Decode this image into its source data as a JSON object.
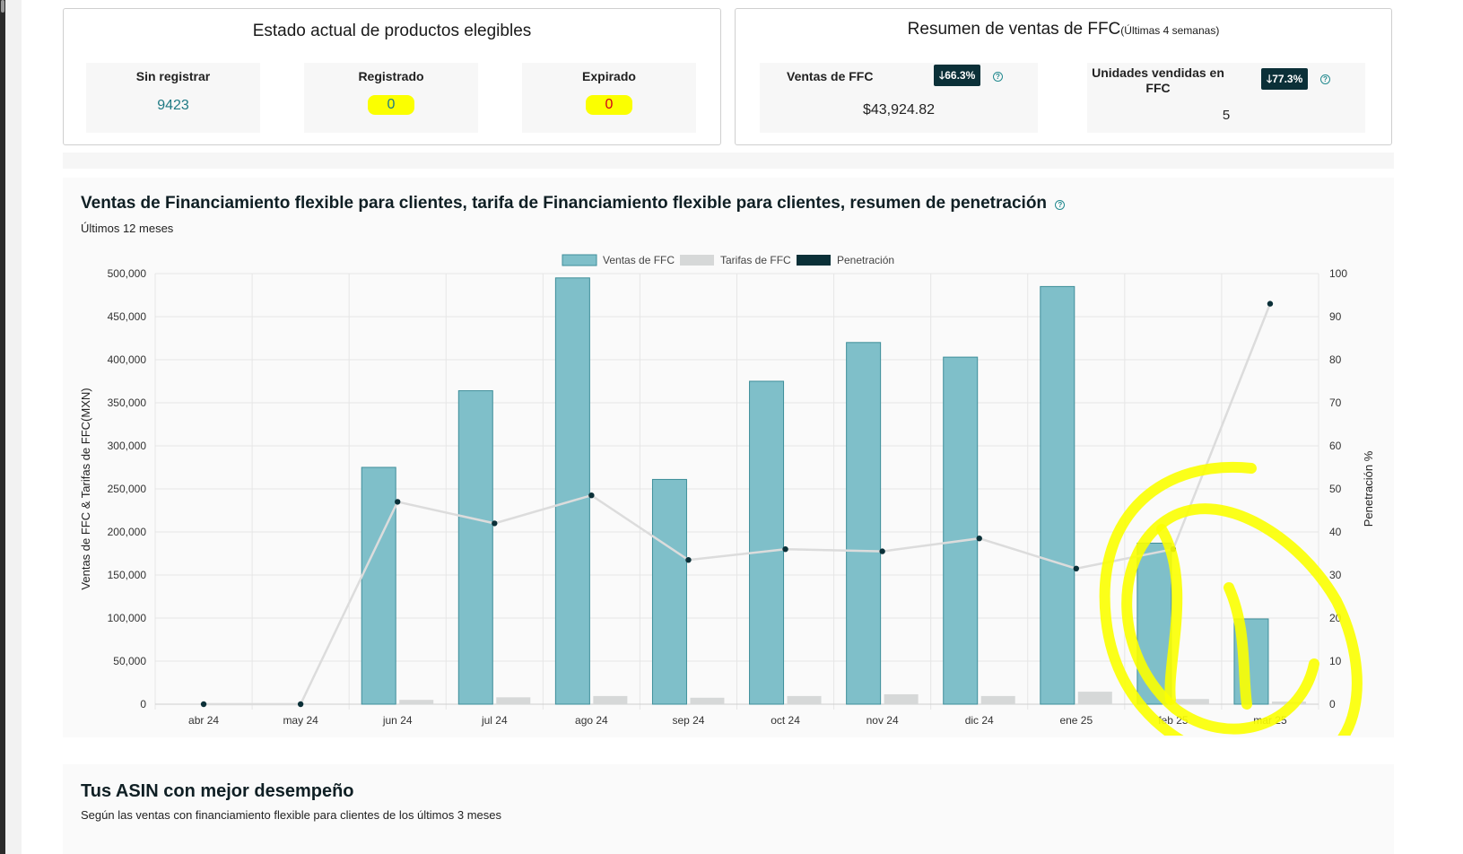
{
  "eligible_status": {
    "title": "Estado actual de productos elegibles",
    "tiles": [
      {
        "label": "Sin registrar",
        "value": "9423",
        "color": "#1f7a84"
      },
      {
        "label": "Registrado",
        "value": "0",
        "color": "#1f7a84"
      },
      {
        "label": "Expirado",
        "value": "0",
        "color": "#d0021b"
      }
    ]
  },
  "sales_summary": {
    "title": "Resumen de ventas de FFC",
    "period": "(Últimas 4 semanas)",
    "ffc_sales": {
      "label": "Ventas de FFC",
      "badge": "66.3%",
      "value": "$43,924.82"
    },
    "ffc_units": {
      "label": "Unidades vendidas en FFC",
      "badge": "77.3%",
      "value": "5"
    }
  },
  "chart_section": {
    "title": "Ventas de Financiamiento flexible para clientes, tarifa de Financiamiento flexible para clientes, resumen de penetración",
    "subtitle": "Últimos 12 meses"
  },
  "chart_data": {
    "type": "bar",
    "categories": [
      "abr 24",
      "may 24",
      "jun 24",
      "jul 24",
      "ago 24",
      "sep 24",
      "oct 24",
      "nov 24",
      "dic 24",
      "ene 25",
      "feb 25",
      "mar 25"
    ],
    "series": [
      {
        "name": "Ventas de FFC",
        "type": "bar",
        "axis": "left",
        "color": "#7fbfc9",
        "values": [
          0,
          0,
          275000,
          364000,
          495000,
          261000,
          375000,
          420000,
          403000,
          485000,
          187000,
          99000
        ]
      },
      {
        "name": "Tarifas de FFC",
        "type": "bar",
        "axis": "left",
        "color": "#d6d8d8",
        "values": [
          0,
          0,
          5000,
          8000,
          9500,
          7500,
          9500,
          11500,
          9500,
          14500,
          6000,
          3000
        ]
      },
      {
        "name": "Penetración",
        "type": "line",
        "axis": "right",
        "color": "#0b3038",
        "values": [
          0,
          0,
          47,
          42,
          48.5,
          33.5,
          36,
          35.5,
          38.5,
          31.5,
          36,
          93
        ]
      }
    ],
    "ylabel": "Ventas de FFC & Tarifas de FFC(MXN)",
    "y2label": "Penetración %",
    "ylim": [
      0,
      500000
    ],
    "y2lim": [
      0,
      100
    ],
    "yticks": [
      "0",
      "50,000",
      "100,000",
      "150,000",
      "200,000",
      "250,000",
      "300,000",
      "350,000",
      "400,000",
      "450,000",
      "500,000"
    ],
    "y2ticks": [
      "0",
      "10",
      "20",
      "30",
      "40",
      "50",
      "60",
      "70",
      "80",
      "90",
      "100"
    ],
    "legend_position": "top-center",
    "grid": true
  },
  "top_asin": {
    "title": "Tus ASIN con mejor desempeño",
    "subtitle": "Según las ventas con financiamiento flexible para clientes de los últimos 3 meses"
  },
  "annotation_color": "#fbff00"
}
